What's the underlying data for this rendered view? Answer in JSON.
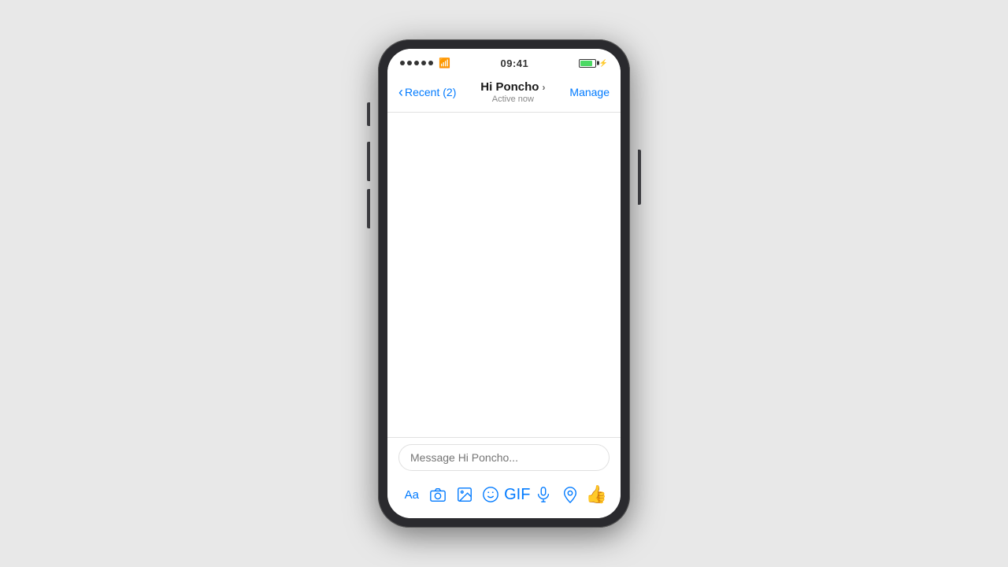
{
  "status_bar": {
    "time": "09:41",
    "signal_count": 5,
    "wifi": "wifi"
  },
  "nav": {
    "back_label": "Recent (2)",
    "title": "Hi Poncho",
    "title_chevron": "›",
    "subtitle": "Active now",
    "manage_label": "Manage"
  },
  "message_area": {
    "empty": true
  },
  "input": {
    "placeholder": "Message Hi Poncho..."
  },
  "toolbar": {
    "keyboard_label": "Aa",
    "camera_title": "camera",
    "photo_title": "photo",
    "emoji_title": "emoji",
    "gif_label": "GIF",
    "mic_title": "microphone",
    "location_title": "location",
    "like_title": "thumbs up"
  }
}
